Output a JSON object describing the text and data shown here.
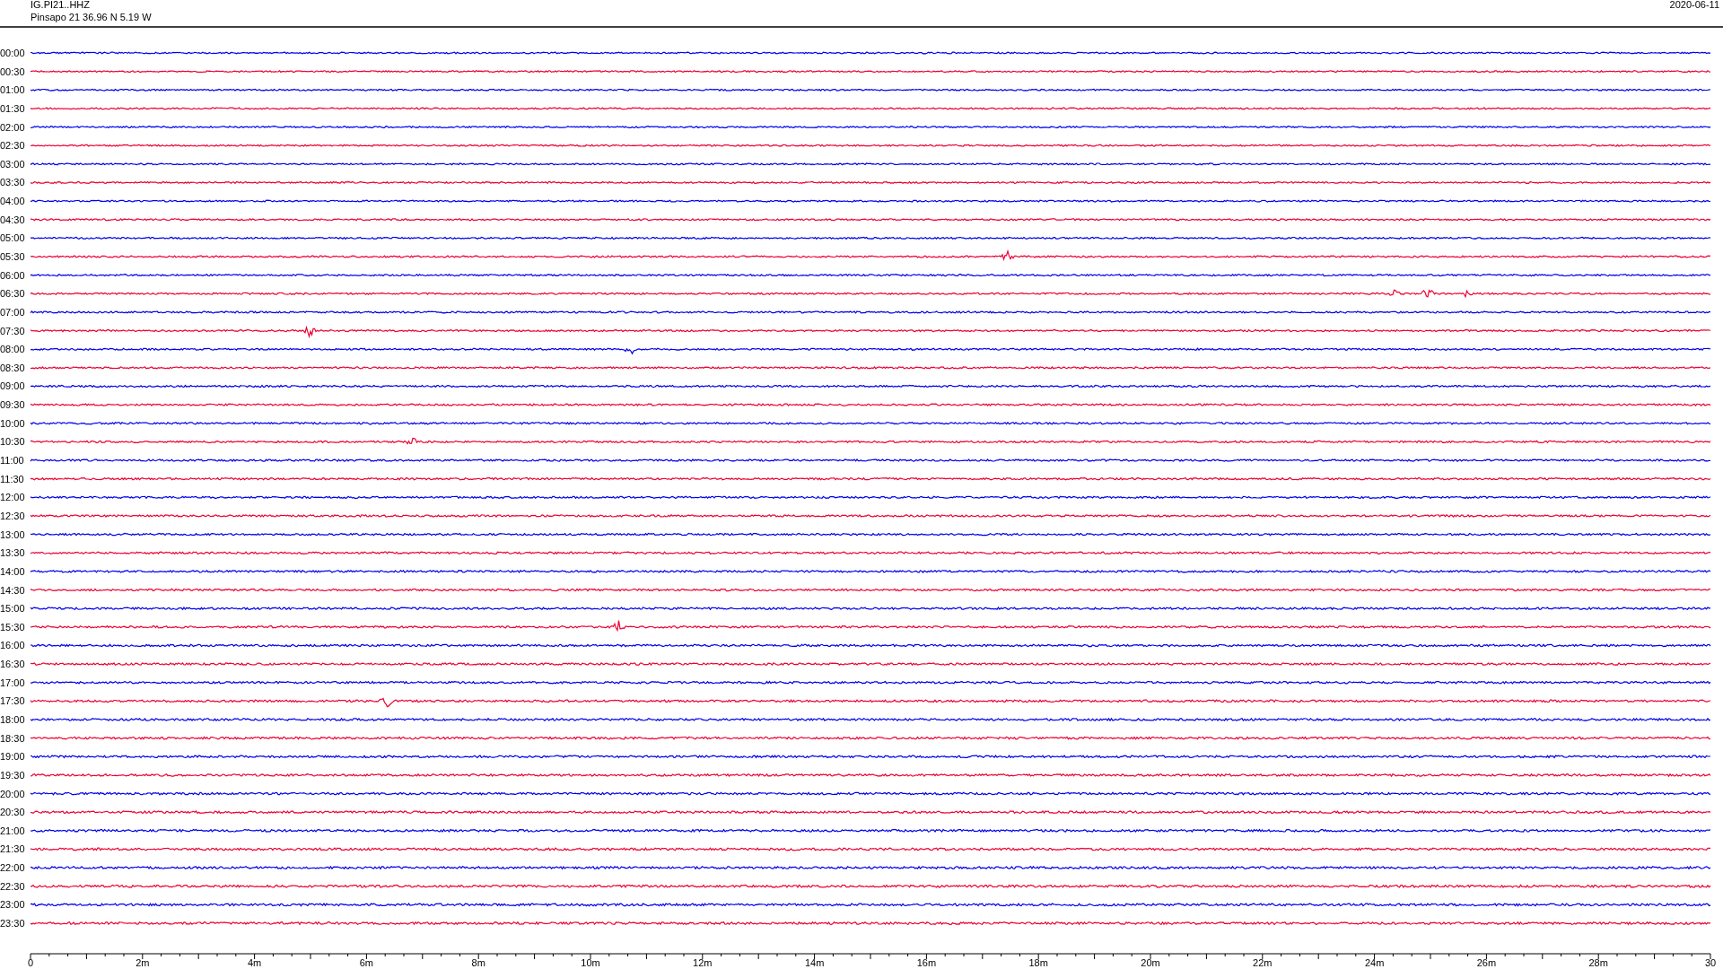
{
  "header": {
    "channel": "IG.PI21..HHZ",
    "station": "Pinsapo 21  36.96 N 5.19 W",
    "date": "2020-06-11"
  },
  "rows": [
    {
      "label": "00:00",
      "color": "#0000ee"
    },
    {
      "label": "00:30",
      "color": "#ee0033"
    },
    {
      "label": "01:00",
      "color": "#0000ee"
    },
    {
      "label": "01:30",
      "color": "#ee0033"
    },
    {
      "label": "02:00",
      "color": "#0000ee"
    },
    {
      "label": "02:30",
      "color": "#ee0033"
    },
    {
      "label": "03:00",
      "color": "#0000ee"
    },
    {
      "label": "03:30",
      "color": "#ee0033"
    },
    {
      "label": "04:00",
      "color": "#0000ee"
    },
    {
      "label": "04:30",
      "color": "#ee0033"
    },
    {
      "label": "05:00",
      "color": "#0000ee"
    },
    {
      "label": "05:30",
      "color": "#ee0033"
    },
    {
      "label": "06:00",
      "color": "#0000ee"
    },
    {
      "label": "06:30",
      "color": "#ee0033"
    },
    {
      "label": "07:00",
      "color": "#0000ee"
    },
    {
      "label": "07:30",
      "color": "#ee0033"
    },
    {
      "label": "08:00",
      "color": "#0000ee"
    },
    {
      "label": "08:30",
      "color": "#ee0033"
    },
    {
      "label": "09:00",
      "color": "#0000ee"
    },
    {
      "label": "09:30",
      "color": "#ee0033"
    },
    {
      "label": "10:00",
      "color": "#0000ee"
    },
    {
      "label": "10:30",
      "color": "#ee0033"
    },
    {
      "label": "11:00",
      "color": "#0000ee"
    },
    {
      "label": "11:30",
      "color": "#ee0033"
    },
    {
      "label": "12:00",
      "color": "#0000ee"
    },
    {
      "label": "12:30",
      "color": "#ee0033"
    },
    {
      "label": "13:00",
      "color": "#0000ee"
    },
    {
      "label": "13:30",
      "color": "#ee0033"
    },
    {
      "label": "14:00",
      "color": "#0000ee"
    },
    {
      "label": "14:30",
      "color": "#ee0033"
    },
    {
      "label": "15:00",
      "color": "#0000ee"
    },
    {
      "label": "15:30",
      "color": "#ee0033"
    },
    {
      "label": "16:00",
      "color": "#0000ee"
    },
    {
      "label": "16:30",
      "color": "#ee0033"
    },
    {
      "label": "17:00",
      "color": "#0000ee"
    },
    {
      "label": "17:30",
      "color": "#ee0033"
    },
    {
      "label": "18:00",
      "color": "#0000ee"
    },
    {
      "label": "18:30",
      "color": "#ee0033"
    },
    {
      "label": "19:00",
      "color": "#0000ee"
    },
    {
      "label": "19:30",
      "color": "#ee0033"
    },
    {
      "label": "20:00",
      "color": "#0000ee"
    },
    {
      "label": "20:30",
      "color": "#ee0033"
    },
    {
      "label": "21:00",
      "color": "#0000ee"
    },
    {
      "label": "21:30",
      "color": "#ee0033"
    },
    {
      "label": "22:00",
      "color": "#0000ee"
    },
    {
      "label": "22:30",
      "color": "#ee0033"
    },
    {
      "label": "23:00",
      "color": "#0000ee"
    },
    {
      "label": "23:30",
      "color": "#ee0033"
    }
  ],
  "axis_labels": [
    "0",
    "2m",
    "4m",
    "6m",
    "8m",
    "10m",
    "12m",
    "14m",
    "16m",
    "18m",
    "20m",
    "22m",
    "24m",
    "26m",
    "28m",
    "30"
  ]
}
